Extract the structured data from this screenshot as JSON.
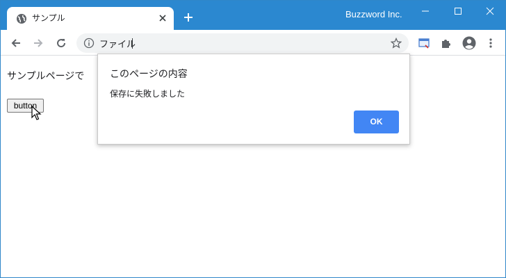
{
  "browser": {
    "tab": {
      "title": "サンプル",
      "icon": "globe-icon",
      "close_icon": "close-icon"
    },
    "new_tab_icon": "plus-icon",
    "profile_label": "Buzzword Inc.",
    "window_controls": [
      "minimize-icon",
      "maximize-icon",
      "close-icon"
    ],
    "colors": {
      "titlebar": "#2b88d0",
      "ok_button": "#4286f4"
    }
  },
  "toolbar": {
    "address": {
      "prefix_icon": "info-icon",
      "text": "ファイル"
    },
    "icons": [
      "back-arrow-icon",
      "forward-arrow-icon",
      "reload-icon",
      "bookmark-star-icon",
      "screenshot-extension-icon",
      "extensions-puzzle-icon",
      "profile-avatar-icon",
      "more-menu-icon"
    ]
  },
  "page": {
    "text": "サンプルページで",
    "button_label": "button"
  },
  "dialog": {
    "title": "このページの内容",
    "message": "保存に失敗しました",
    "ok_label": "OK"
  }
}
